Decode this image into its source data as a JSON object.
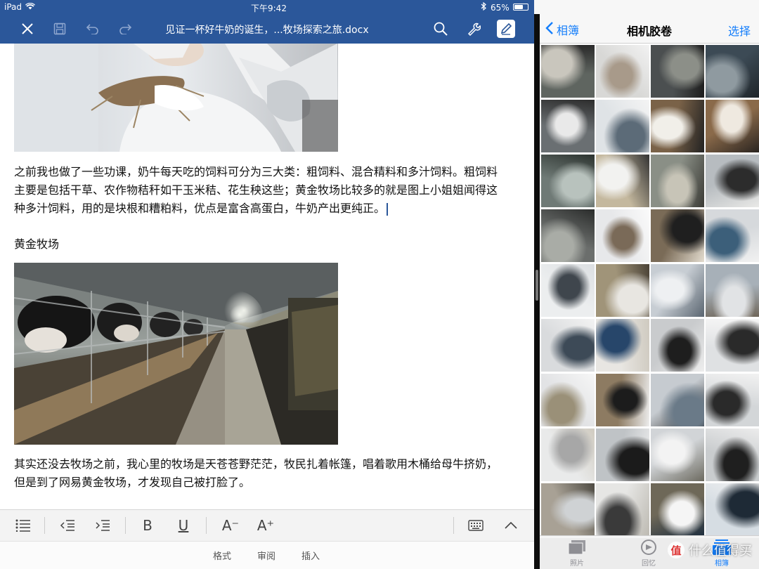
{
  "status_bar": {
    "device": "iPad",
    "time": "下午9:42",
    "battery": "65%",
    "battery_level": 0.65
  },
  "word": {
    "title": "见证一杯好牛奶的诞生，...牧场探索之旅.docx",
    "icons": [
      "close-icon",
      "save-icon",
      "undo-icon",
      "redo-icon",
      "search-icon",
      "wrench-icon",
      "pen-icon"
    ],
    "paragraphs": {
      "p1": "之前我也做了一些功课，奶牛每天吃的饲料可分为三大类：粗饲料、混合精料和多汁饲料。粗饲料主要是包括干草、农作物秸秆如干玉米秸、花生秧这些；黄金牧场比较多的就是图上小姐姐闻得这种多汁饲料，用的是块根和糟粕料，优点是富含高蛋白，牛奶产出更纯正。",
      "heading": "黄金牧场",
      "p2": "其实还没去牧场之前，我心里的牧场是天苍苍野茫茫，牧民扎着帐篷，唱着歌用木桶给母牛挤奶，但是到了网易黄金牧场，才发现自己被打脸了。"
    },
    "toolbar": {
      "bold": "B",
      "underline": "U",
      "font_decrease": "A⁻",
      "font_increase": "A⁺"
    },
    "ribbon_tabs": [
      "格式",
      "审阅",
      "插入"
    ]
  },
  "photos": {
    "back_label": "相簿",
    "title": "相机胶卷",
    "select_label": "选择",
    "tabs": [
      {
        "label": "照片",
        "icon": "photos-icon",
        "active": false
      },
      {
        "label": "回忆",
        "icon": "memories-icon",
        "active": false
      },
      {
        "label": "相簿",
        "icon": "albums-icon",
        "active": true
      }
    ]
  },
  "watermark": {
    "logo": "值",
    "text": "什么值得买"
  },
  "colors": {
    "word_blue": "#2b579a",
    "ios_blue": "#147efb"
  }
}
